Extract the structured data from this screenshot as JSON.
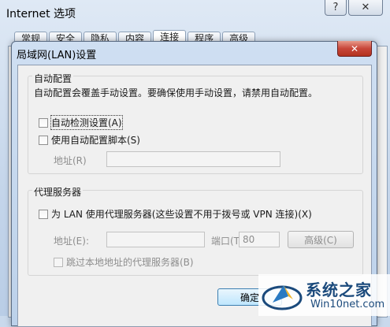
{
  "background_window": {
    "title": "Internet 选项",
    "help_glyph": "?",
    "close_glyph": "✕",
    "tabs": [
      "常规",
      "安全",
      "隐私",
      "内容",
      "连接",
      "程序",
      "高级"
    ],
    "active_tab_index": 4
  },
  "dialog": {
    "title": "局域网(LAN)设置",
    "close_glyph": "✕",
    "auto_config": {
      "group_label": "自动配置",
      "description": "自动配置会覆盖手动设置。要确保使用手动设置，请禁用自动配置。",
      "auto_detect_label": "自动检测设置(A)",
      "auto_detect_checked": false,
      "use_script_label": "使用自动配置脚本(S)",
      "use_script_checked": false,
      "address_label": "地址(R)",
      "address_value": ""
    },
    "proxy": {
      "group_label": "代理服务器",
      "use_proxy_label": "为 LAN 使用代理服务器(这些设置不用于拨号或 VPN 连接)(X)",
      "use_proxy_checked": false,
      "address_label": "地址(E):",
      "address_value": "",
      "port_label": "端口(T):",
      "port_value": "80",
      "advanced_label": "高级(C)",
      "bypass_local_label": "跳过本地地址的代理服务器(B)",
      "bypass_local_checked": false
    },
    "ok_label": "确定"
  },
  "watermark": {
    "brand": "系统之家",
    "site": "Win10net.com"
  }
}
